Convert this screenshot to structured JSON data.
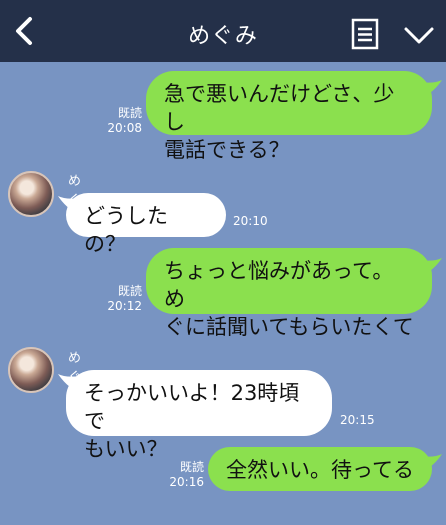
{
  "header": {
    "title": "めぐみ"
  },
  "messages": [
    {
      "side": "me",
      "text": "急で悪いんだけどさ、少し\n電話できる？",
      "read": "既読",
      "time": "20:08"
    },
    {
      "side": "other",
      "sender": "めぐみ",
      "text": "どうしたの？",
      "time": "20:10"
    },
    {
      "side": "me",
      "text": "ちょっと悩みがあって。め\nぐに話聞いてもらいたくて",
      "read": "既読",
      "time": "20:12"
    },
    {
      "side": "other",
      "sender": "めぐみ",
      "text": "そっかいいよ！23時頃で\nもいい？",
      "time": "20:15"
    },
    {
      "side": "me",
      "text": "全然いい。待ってる",
      "read": "既読",
      "time": "20:16"
    }
  ],
  "colors": {
    "background": "#7894c2",
    "header": "#243049",
    "my_bubble": "#8be04e",
    "their_bubble": "#ffffff"
  },
  "icons": {
    "back": "chevron-left-icon",
    "notes": "notes-icon",
    "menu": "chevron-down-icon"
  }
}
